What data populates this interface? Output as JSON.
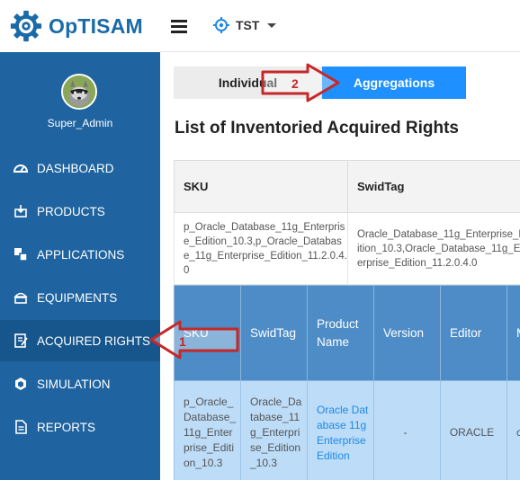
{
  "app": {
    "name": "OpTISAM"
  },
  "header": {
    "scope": "TST",
    "menu_icon": "hamburger-icon",
    "scope_icon": "crosshair-icon"
  },
  "sidebar": {
    "user": {
      "name": "Super_Admin"
    },
    "items": [
      {
        "label": "DASHBOARD",
        "icon": "dashboard-icon"
      },
      {
        "label": "PRODUCTS",
        "icon": "products-icon"
      },
      {
        "label": "APPLICATIONS",
        "icon": "applications-icon"
      },
      {
        "label": "EQUIPMENTS",
        "icon": "equipments-icon"
      },
      {
        "label": "ACQUIRED RIGHTS",
        "icon": "acquired-rights-icon"
      },
      {
        "label": "SIMULATION",
        "icon": "simulation-icon"
      },
      {
        "label": "REPORTS",
        "icon": "reports-icon"
      }
    ]
  },
  "main": {
    "tabs": [
      {
        "label": "Individual"
      },
      {
        "label": "Aggregations"
      }
    ],
    "title": "List of Inventoried Acquired Rights",
    "summary_table": {
      "headers": [
        "SKU",
        "SwidTag"
      ],
      "row": [
        "p_Oracle_Database_11g_Enterprise_Edition_10.3,p_Oracle_Database_11g_Enterprise_Edition_11.2.0.4.0",
        "Oracle_Database_11g_Enterprise_Edition_10.3,Oracle_Database_11g_Enterprise_Edition_11.2.0.4.0"
      ]
    },
    "detail_table": {
      "headers": [
        "SKU",
        "SwidTag",
        "Product Name",
        "Version",
        "Editor",
        "M"
      ],
      "row": [
        "p_Oracle_Database_11g_Enterprise_Edition_10.3",
        "Oracle_Database_11g_Enterprise_Edition_10.3",
        "Oracle Database 11g Enterprise Edition",
        "-",
        "ORACLE",
        "c"
      ]
    }
  },
  "annotations": [
    {
      "label": "1",
      "color": "#c62828"
    },
    {
      "label": "2",
      "color": "#c62828"
    }
  ]
}
